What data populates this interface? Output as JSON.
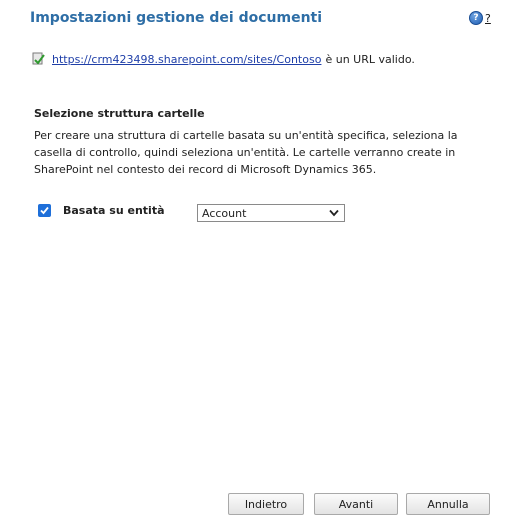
{
  "dialog": {
    "title": "Impostazioni gestione dei documenti",
    "help_label": "?"
  },
  "url_check": {
    "url": "https://crm423498.sharepoint.com/sites/Contoso",
    "suffix": "è un URL valido."
  },
  "folder_section": {
    "title": "Selezione struttura cartelle",
    "description": "Per creare una struttura di cartelle basata su un'entità specifica, seleziona la casella di controllo, quindi seleziona un'entità. Le cartelle verranno create in SharePoint nel contesto dei record di Microsoft Dynamics 365.",
    "checkbox_label": "Basata su entità",
    "checkbox_checked": true,
    "entity_selected": "Account"
  },
  "buttons": {
    "back": "Indietro",
    "next": "Avanti",
    "cancel": "Annulla"
  },
  "colors": {
    "title": "#2e6ea6",
    "link": "#1f3fa8",
    "checkbox": "#1e6fd9"
  },
  "icons": {
    "help": "help-icon",
    "valid_url": "valid-url-check-icon",
    "dropdown": "chevron-down-icon",
    "checkbox": "checkmark-icon"
  }
}
